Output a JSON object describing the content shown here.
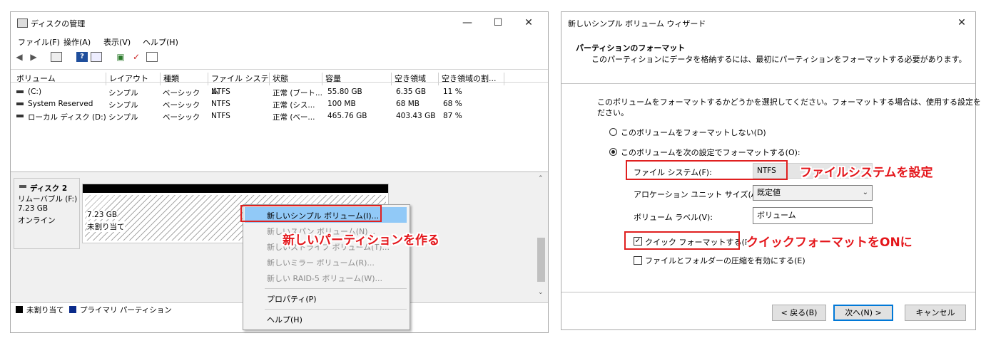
{
  "disk_mgmt": {
    "title": "ディスクの管理",
    "menu": [
      "ファイル(F)",
      "操作(A)",
      "表示(V)",
      "ヘルプ(H)"
    ],
    "columns": [
      "ボリューム",
      "レイアウト",
      "種類",
      "ファイル システム",
      "状態",
      "容量",
      "空き領域",
      "空き領域の割..."
    ],
    "rows": [
      [
        "(C:)",
        "シンプル",
        "ベーシック",
        "NTFS",
        "正常 (ブート...",
        "55.80 GB",
        "6.35 GB",
        "11 %"
      ],
      [
        "System Reserved",
        "シンプル",
        "ベーシック",
        "NTFS",
        "正常 (シス...",
        "100 MB",
        "68 MB",
        "68 %"
      ],
      [
        "ローカル ディスク (D:)",
        "シンプル",
        "ベーシック",
        "NTFS",
        "正常 (ベー...",
        "465.76 GB",
        "403.43 GB",
        "87 %"
      ]
    ],
    "disk": {
      "name": "ディスク 2",
      "type": "リムーバブル (F:)",
      "size": "7.23 GB",
      "status": "オンライン",
      "partition_size": "7.23 GB",
      "partition_status": "未割り当て"
    },
    "legend": [
      "未割り当て",
      "プライマリ パーティション"
    ],
    "context_menu": {
      "items": [
        {
          "label": "新しいシンプル ボリューム(I)...",
          "enabled": true
        },
        {
          "label": "新しいスパン ボリューム(N)...",
          "enabled": false
        },
        {
          "label": "新しいストライプ ボリューム(T)...",
          "enabled": false
        },
        {
          "label": "新しいミラー ボリューム(R)...",
          "enabled": false
        },
        {
          "label": "新しい RAID-5 ボリューム(W)...",
          "enabled": false
        },
        {
          "label": "プロパティ(P)",
          "enabled": true
        },
        {
          "label": "ヘルプ(H)",
          "enabled": true
        }
      ]
    },
    "annotation": "新しいパーティションを作る"
  },
  "wizard": {
    "title": "新しいシンプル ボリューム ウィザード",
    "header_title": "パーティションのフォーマット",
    "header_desc": "このパーティションにデータを格納するには、最初にパーティションをフォーマットする必要があります。",
    "instruction_line1": "このボリュームをフォーマットするかどうかを選択してください。フォーマットする場合は、使用する設定を選択してく",
    "instruction_line2": "ださい。",
    "radio_no_format": "このボリュームをフォーマットしない(D)",
    "radio_format": "このボリュームを次の設定でフォーマットする(O):",
    "fs_label": "ファイル システム(F):",
    "fs_value": "NTFS",
    "alloc_label": "アロケーション ユニット サイズ(A):",
    "alloc_value": "既定値",
    "vol_label_label": "ボリューム ラベル(V):",
    "vol_label_value": "ボリューム",
    "quick_format": "クイック フォーマットする(P)",
    "compress": "ファイルとフォルダーの圧縮を有効にする(E)",
    "btn_back": "< 戻る(B)",
    "btn_next": "次へ(N) >",
    "btn_cancel": "キャンセル",
    "annotation_fs": "ファイルシステムを設定",
    "annotation_quick": "クイックフォーマットをONに"
  },
  "colors": {
    "accent": "#0078d7",
    "annotation": "#e4161b",
    "highlight": "#91c9f7",
    "primary_partition": "#0a2a8a"
  }
}
